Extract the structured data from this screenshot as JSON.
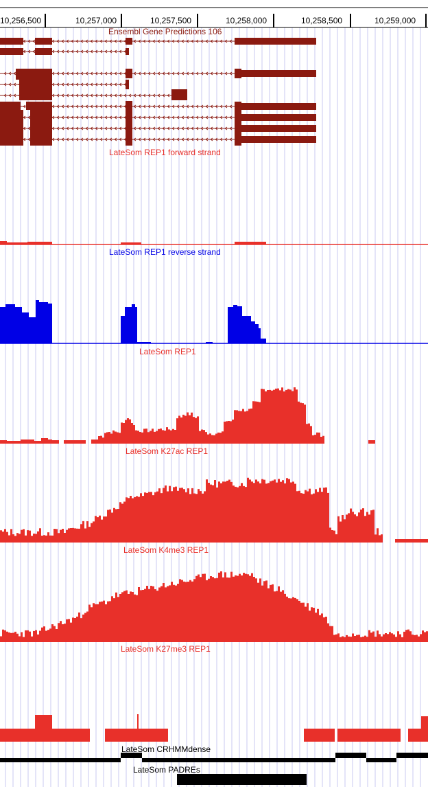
{
  "ruler": {
    "labels": [
      "10,256,500",
      "10,257,000",
      "10,257,500",
      "10,258,000",
      "10,258,500",
      "10,259,000"
    ]
  },
  "tracks": [
    {
      "id": "ensembl",
      "label": "Ensembl Gene Predictions 106",
      "color": "#8B1A10"
    },
    {
      "id": "rep1_fwd",
      "label": "LateSom REP1 forward strand",
      "color": "#E8302A"
    },
    {
      "id": "rep1_rev",
      "label": "LateSom REP1 reverse strand",
      "color": "#0000E6"
    },
    {
      "id": "rep1",
      "label": "LateSom REP1",
      "color": "#E8302A"
    },
    {
      "id": "k27ac",
      "label": "LateSom K27ac REP1",
      "color": "#E8302A"
    },
    {
      "id": "k4me3",
      "label": "LateSom K4me3 REP1",
      "color": "#E8302A"
    },
    {
      "id": "k27me3",
      "label": "LateSom K27me3 REP1",
      "color": "#E8302A"
    },
    {
      "id": "crhmm",
      "label": "LateSom CRHMMdense",
      "color": "#000000"
    },
    {
      "id": "padres",
      "label": "LateSom PADREs",
      "color": "#000000"
    }
  ]
}
